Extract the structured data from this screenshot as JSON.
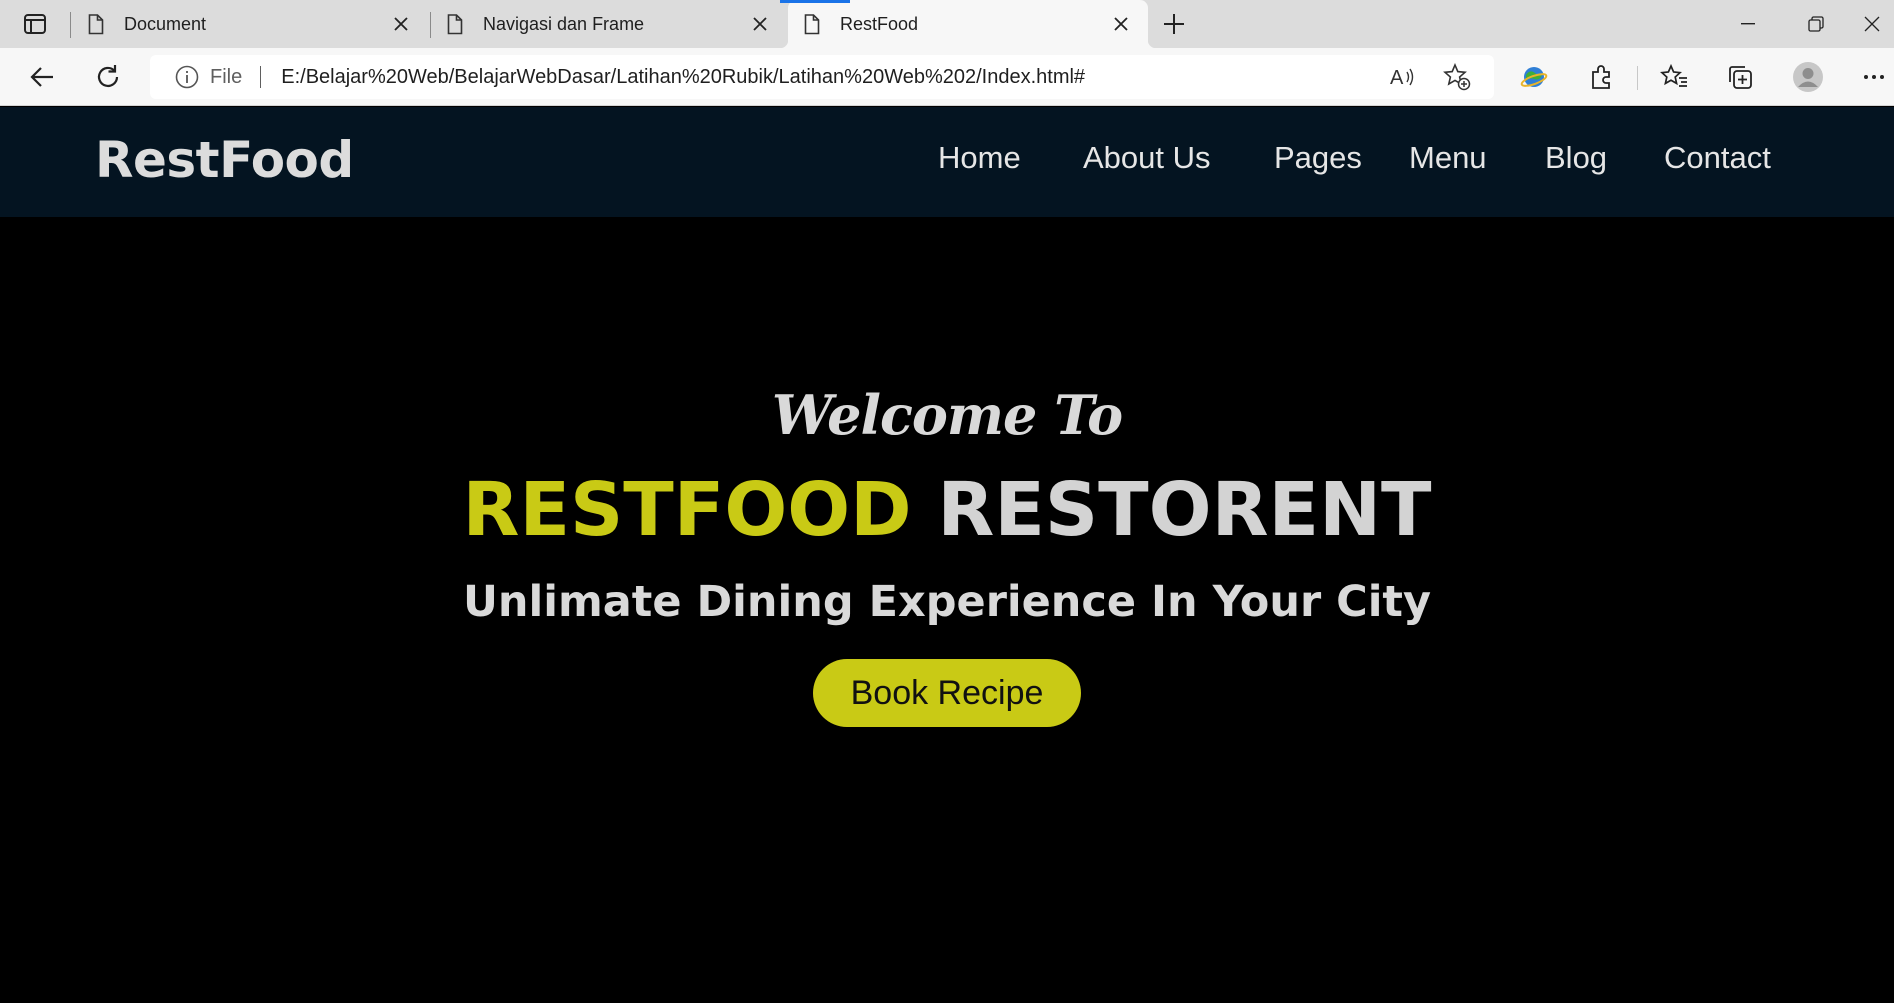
{
  "browser": {
    "tabs": [
      {
        "title": "Document"
      },
      {
        "title": "Navigasi dan Frame"
      },
      {
        "title": "RestFood"
      }
    ],
    "address": {
      "scheme": "File",
      "url": "E:/Belajar%20Web/BelajarWebDasar/Latihan%20Rubik/Latihan%20Web%202/Index.html#"
    }
  },
  "site": {
    "logo": "RestFood",
    "nav": [
      "Home",
      "About Us",
      "Pages",
      "Menu",
      "Blog",
      "Contact"
    ],
    "hero": {
      "welcome": "Welcome To",
      "brand": "RESTFOOD",
      "rest": "RESTORENT",
      "tagline": "Unlimate Dining Experience In Your City",
      "cta": "Book Recipe"
    }
  },
  "colors": {
    "header_bg": "#041421",
    "accent": "#c9ca15",
    "hero_bg": "#000000"
  }
}
